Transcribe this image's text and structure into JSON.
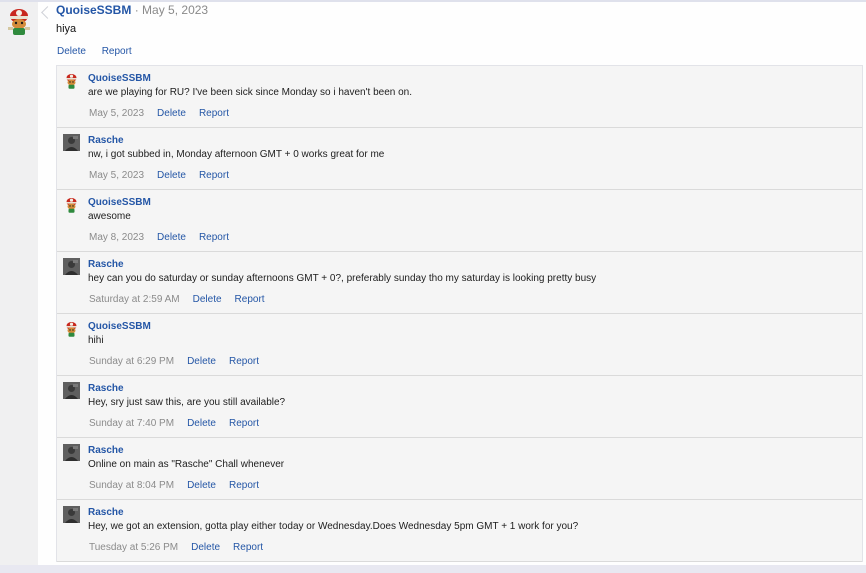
{
  "post": {
    "author": "QuoiseSSBM",
    "separator": "·",
    "date": "May 5, 2023",
    "body": "hiya",
    "actions": [
      "Delete",
      "Report"
    ],
    "avatar_icon": "fox-character-icon"
  },
  "comments": [
    {
      "author": "QuoiseSSBM",
      "avatar": "fox-character-icon",
      "text": "are we playing for RU? I've been sick since Monday so i haven't been on.",
      "when": "May 5, 2023",
      "delete": "Delete",
      "report": "Report"
    },
    {
      "author": "Rasche",
      "avatar": "dark-avatar-icon",
      "text": "nw, i got subbed in, Monday afternoon GMT + 0 works great for me",
      "when": "May 5, 2023",
      "delete": "Delete",
      "report": "Report"
    },
    {
      "author": "QuoiseSSBM",
      "avatar": "fox-character-icon",
      "text": "awesome",
      "when": "May 8, 2023",
      "delete": "Delete",
      "report": "Report"
    },
    {
      "author": "Rasche",
      "avatar": "dark-avatar-icon",
      "text": "hey can you do saturday or sunday afternoons GMT + 0?, preferably sunday tho my saturday is looking pretty busy",
      "when": "Saturday at 2:59 AM",
      "delete": "Delete",
      "report": "Report"
    },
    {
      "author": "QuoiseSSBM",
      "avatar": "fox-character-icon",
      "text": "hihi",
      "when": "Sunday at 6:29 PM",
      "delete": "Delete",
      "report": "Report"
    },
    {
      "author": "Rasche",
      "avatar": "dark-avatar-icon",
      "text": "Hey, sry just saw this, are you still available?",
      "when": "Sunday at 7:40 PM",
      "delete": "Delete",
      "report": "Report"
    },
    {
      "author": "Rasche",
      "avatar": "dark-avatar-icon",
      "text": "Online on main as \"Rasche\" Chall whenever",
      "when": "Sunday at 8:04 PM",
      "delete": "Delete",
      "report": "Report"
    },
    {
      "author": "Rasche",
      "avatar": "dark-avatar-icon",
      "text": "Hey, we got an extension, gotta play either today or Wednesday.Does Wednesday 5pm GMT + 1 work for you?",
      "when": "Tuesday at 5:26 PM",
      "delete": "Delete",
      "report": "Report"
    }
  ],
  "colors": {
    "link": "#2456a6",
    "muted": "#8b8b8b",
    "comment_bg": "#f5f5f5"
  }
}
